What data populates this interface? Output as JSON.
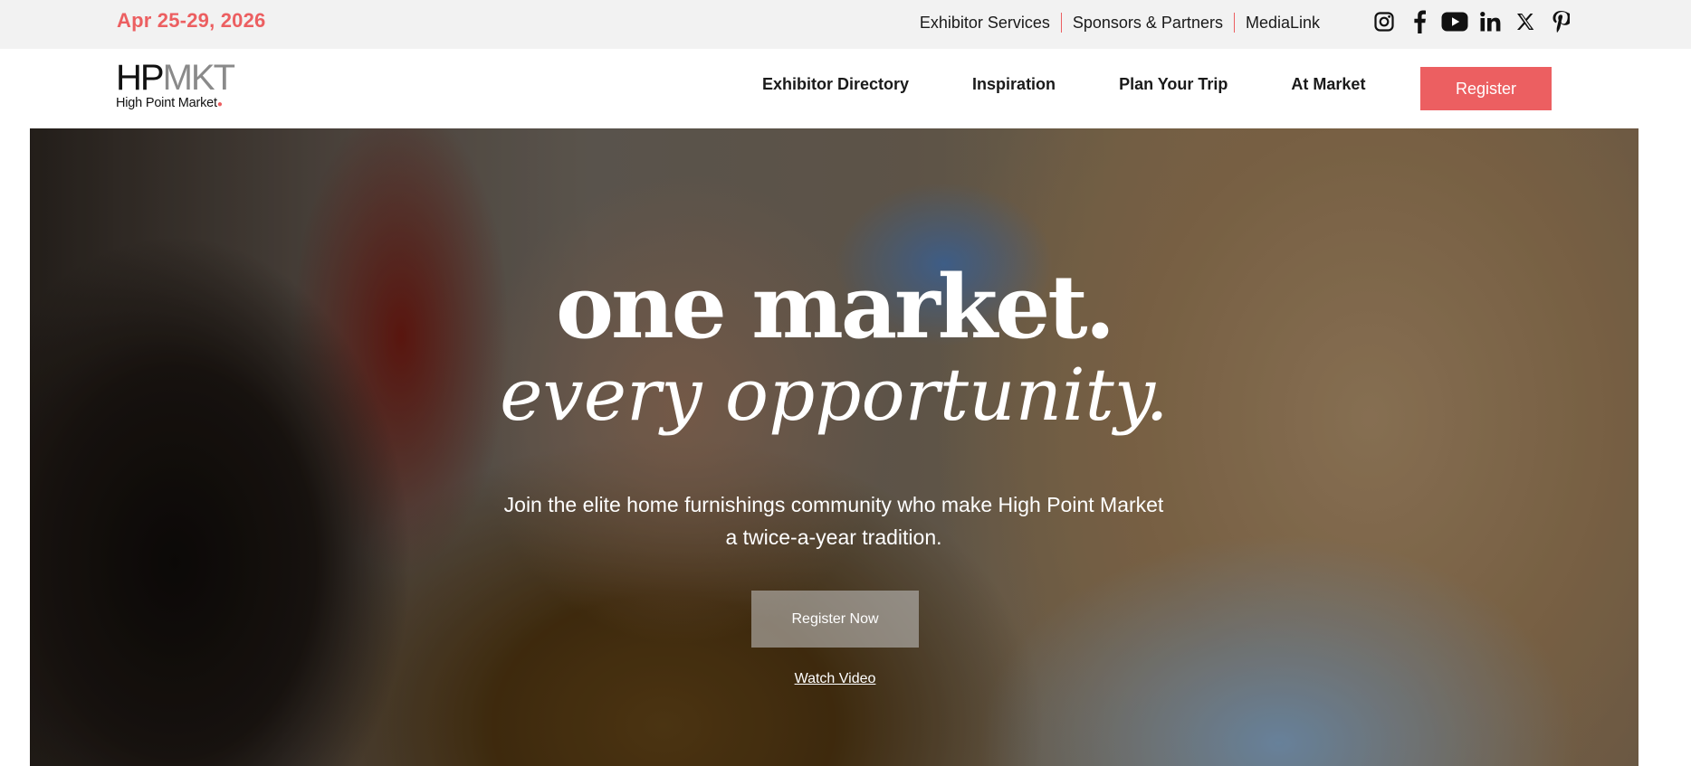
{
  "utility": {
    "date": "Apr 25-29, 2026",
    "links": [
      "Exhibitor Services",
      "Sponsors & Partners",
      "MediaLink"
    ],
    "social_icons": [
      "instagram-icon",
      "facebook-icon",
      "youtube-icon",
      "linkedin-icon",
      "x-icon",
      "pinterest-icon"
    ]
  },
  "header": {
    "logo": {
      "mark_hp": "HP",
      "mark_mkt": "MKT",
      "subtitle": "High Point Market"
    },
    "nav": [
      "Exhibitor Directory",
      "Inspiration",
      "Plan Your Trip",
      "At Market"
    ],
    "register_label": "Register"
  },
  "hero": {
    "headline_1": "one market.",
    "headline_2": "every opportunity.",
    "subtitle_line_1": "Join the elite home furnishings community who make High Point Market",
    "subtitle_line_2": "a twice-a-year tradition.",
    "cta_label": "Register Now",
    "watch_label": "Watch Video"
  },
  "colors": {
    "accent": "#ec5f61",
    "utility_bg": "#f2f2f2",
    "text": "#1a1a1a"
  }
}
